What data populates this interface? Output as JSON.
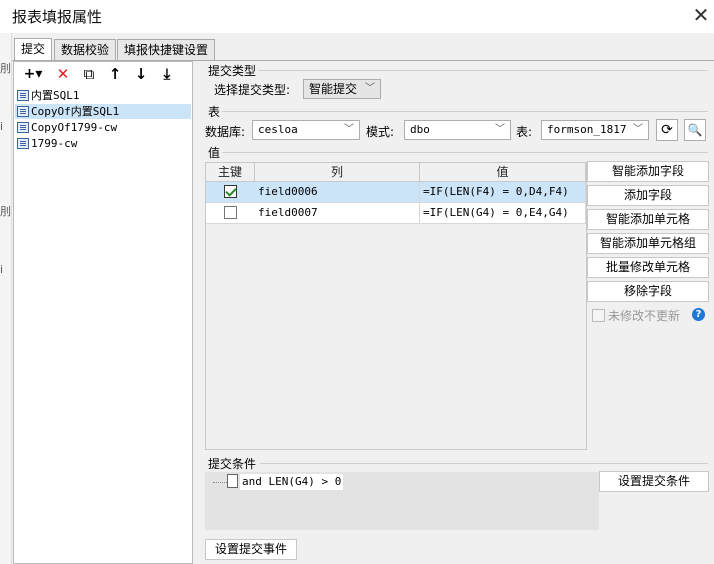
{
  "window": {
    "title": "报表填报属性",
    "close_glyph": "✕"
  },
  "tabs": [
    {
      "label": "提交",
      "active": true
    },
    {
      "label": "数据校验",
      "active": false
    },
    {
      "label": "填报快捷键设置",
      "active": false
    }
  ],
  "left_toolbar": {
    "icons": [
      "add-icon",
      "delete-icon",
      "copy-icon",
      "move-up-icon",
      "move-down-icon",
      "move-bottom-icon"
    ],
    "add_glyph": "+▾",
    "delete_glyph": "✕",
    "copy_glyph": "⧉",
    "up_glyph": "↑",
    "down_glyph": "↓",
    "bottom_glyph": "⤓"
  },
  "tree": [
    {
      "label": "内置SQL1",
      "selected": false
    },
    {
      "label": "CopyOf内置SQL1",
      "selected": true
    },
    {
      "label": "CopyOf1799-cw",
      "selected": false
    },
    {
      "label": "1799-cw",
      "selected": false
    }
  ],
  "submit_type": {
    "group_label": "提交类型",
    "field_label": "选择提交类型:",
    "value": "智能提交"
  },
  "table_section": {
    "group_label": "表",
    "database_label": "数据库:",
    "database_value": "cesloa",
    "schema_label": "模式:",
    "schema_value": "dbo",
    "table_label": "表:",
    "table_value": "formson_1817"
  },
  "value_section": {
    "group_label": "值",
    "columns": [
      "主键",
      "列",
      "值"
    ],
    "rows": [
      {
        "key": true,
        "column": "field0006",
        "value": "=IF(LEN(F4) = 0,D4,F4)",
        "selected": true
      },
      {
        "key": false,
        "column": "field0007",
        "value": "=IF(LEN(G4) = 0,E4,G4)",
        "selected": false
      }
    ],
    "buttons": [
      "智能添加字段",
      "添加字段",
      "智能添加单元格",
      "智能添加单元格组",
      "批量修改单元格",
      "移除字段"
    ],
    "no_update_label": "未修改不更新",
    "help_glyph": "?"
  },
  "submit_condition": {
    "group_label": "提交条件",
    "condition": "and LEN(G4) > 0",
    "set_button": "设置提交条件"
  },
  "submit_event_button": "设置提交事件",
  "accent_color": "#cce4f7",
  "left_edge_marks": [
    "刖",
    "i",
    "刖",
    "i"
  ]
}
